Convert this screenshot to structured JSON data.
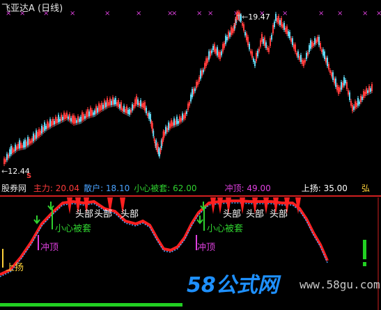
{
  "header": {
    "stock_name": "飞亚达A",
    "period": "(日线)"
  },
  "price_chart": {
    "high_label": "19.47",
    "low_label": "12.44",
    "low_mark": "S"
  },
  "indicator": {
    "source": "股券网",
    "fields": [
      {
        "label": "主力:",
        "value": "20.04",
        "color": "#ff3b3b"
      },
      {
        "label": "散户:",
        "value": "18.10",
        "color": "#4aa3ff"
      },
      {
        "label": "小心被套:",
        "value": "62.00",
        "color": "#2fd12f"
      },
      {
        "label": "冲顶:",
        "value": "49.00",
        "color": "#e040e0"
      },
      {
        "label": "上扬:",
        "value": "35.00",
        "color": "#ffffff"
      }
    ],
    "right_mark": "弘",
    "annotations": {
      "top1": "头部",
      "top2": "头部",
      "top3": "头部",
      "top4": "头部",
      "top5": "头部",
      "top6": "头部",
      "careful1": "小心被套",
      "careful2": "小心被套",
      "peak1": "冲顶",
      "peak2": "冲顶",
      "rise": "上扬"
    }
  },
  "watermark": {
    "brand": "58公式网",
    "url": "www.58gu.com"
  },
  "colors": {
    "up": "#ff3b3b",
    "down": "#5fd6f0",
    "main_force": "#ff2020",
    "retail": "#4aa3ff",
    "axis": "#b00000",
    "bottom_bar": "#22d022"
  }
}
